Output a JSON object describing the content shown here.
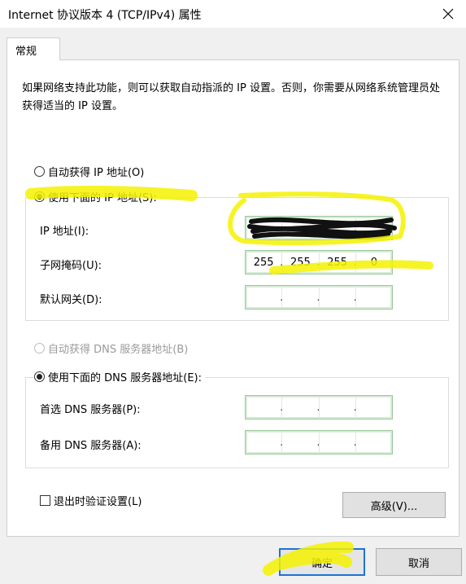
{
  "window": {
    "title": "Internet 协议版本 4 (TCP/IPv4) 属性",
    "close_icon": "close-icon"
  },
  "tabs": [
    {
      "label": "常规"
    }
  ],
  "description": "如果网络支持此功能，则可以获取自动指派的 IP 设置。否则，你需要从网络系统管理员处获得适当的 IP 设置。",
  "ip": {
    "auto_label": "自动获得 IP 地址(O)",
    "manual_label": "使用下面的 IP 地址(S):",
    "manual_selected": true,
    "address_label": "IP 地址(I):",
    "subnet_label": "子网掩码(U):",
    "subnet_octets": [
      "255",
      "255",
      "255",
      "0"
    ],
    "gateway_label": "默认网关(D):"
  },
  "dns": {
    "auto_label": "自动获得 DNS 服务器地址(B)",
    "auto_disabled": true,
    "manual_label": "使用下面的 DNS 服务器地址(E):",
    "preferred_label": "首选 DNS 服务器(P):",
    "alternate_label": "备用 DNS 服务器(A):"
  },
  "validate_label": "退出时验证设置(L)",
  "buttons": {
    "advanced": "高级(V)...",
    "ok": "确定",
    "cancel": "取消"
  },
  "colors": {
    "highlight": "#f5f200",
    "ok_border": "#1e73d4"
  }
}
